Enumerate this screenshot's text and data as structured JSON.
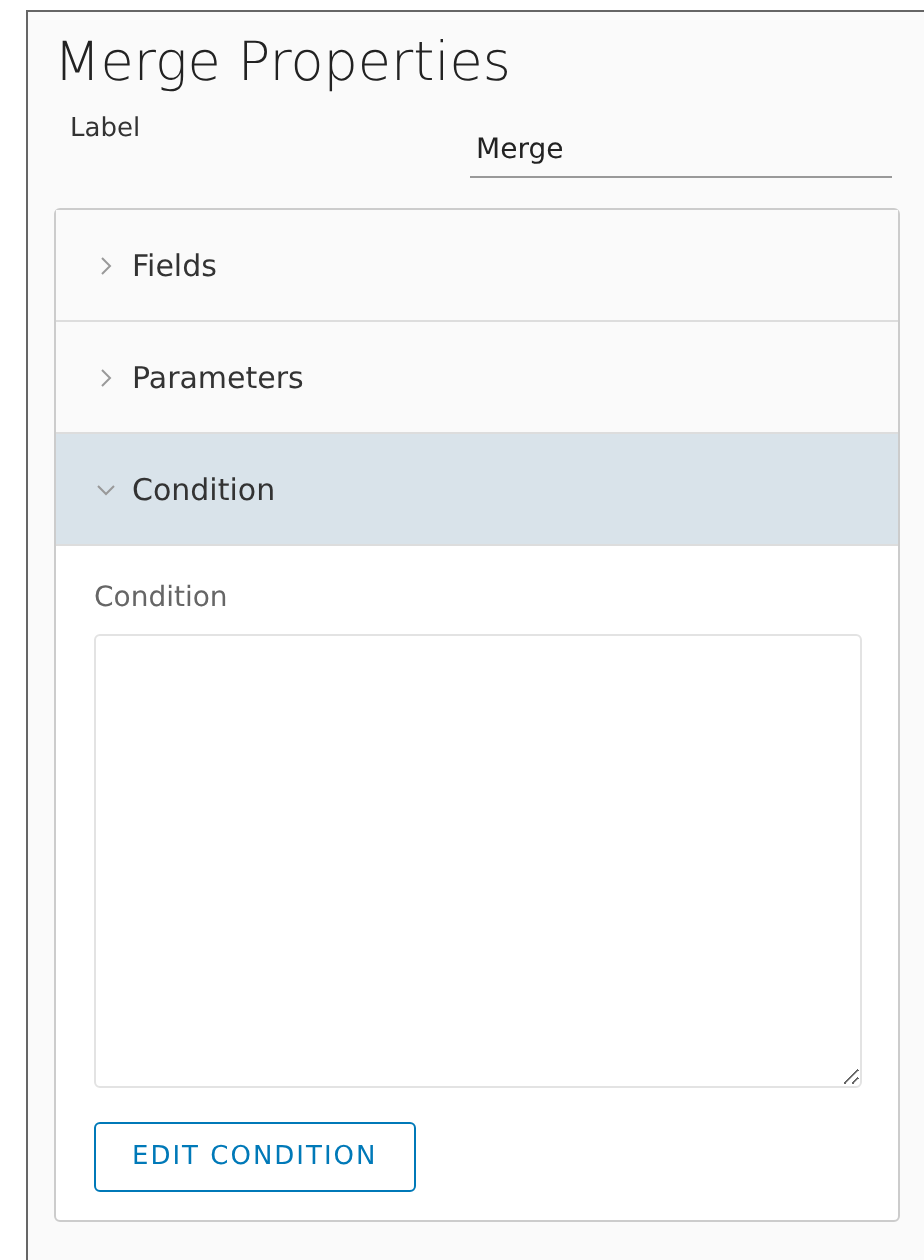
{
  "title": "Merge Properties",
  "label_field": {
    "label": "Label",
    "value": "Merge"
  },
  "sections": [
    {
      "title": "Fields",
      "expanded": false
    },
    {
      "title": "Parameters",
      "expanded": false
    },
    {
      "title": "Condition",
      "expanded": true,
      "field_label": "Condition",
      "button": "EDIT CONDITION"
    }
  ]
}
